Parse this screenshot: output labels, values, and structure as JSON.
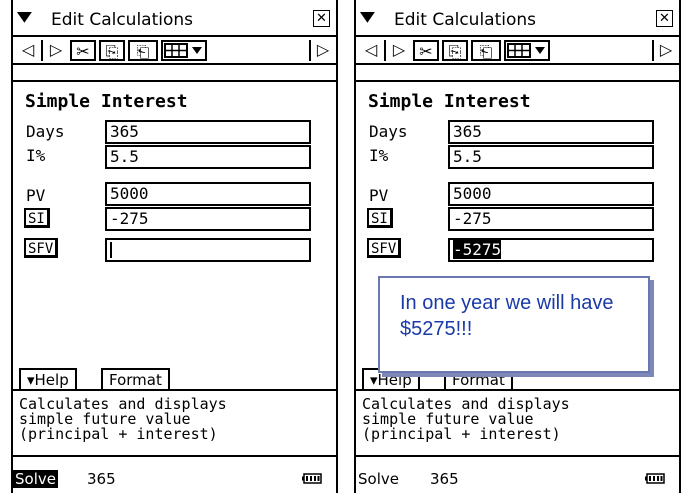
{
  "menu": {
    "title": "Edit  Calculations",
    "arrow": "▼",
    "close": "✕"
  },
  "toolbar": {
    "prev": "◁",
    "next": "▷",
    "cut": "✂",
    "copy": "⎘",
    "paste": "⎗",
    "more": "▷"
  },
  "form": {
    "heading": "Simple Interest",
    "days_label": "Days",
    "interest_label": "I%",
    "pv_label": "PV",
    "si_label": "SI",
    "sfv_label": "SFV"
  },
  "left": {
    "days": "365",
    "interest": "5.5",
    "pv": "5000",
    "si": "-275",
    "sfv": ""
  },
  "right": {
    "days": "365",
    "interest": "5.5",
    "pv": "5000",
    "si": "-275",
    "sfv": "-5275"
  },
  "tabs": {
    "help": "▾Help",
    "format": "Format"
  },
  "help_text": "Calculates and displays\nsimple future value\n(principal + interest)",
  "status": {
    "mode": "Solve",
    "value": "365"
  },
  "callout": {
    "text": "In one year we will have $5275!!!"
  }
}
